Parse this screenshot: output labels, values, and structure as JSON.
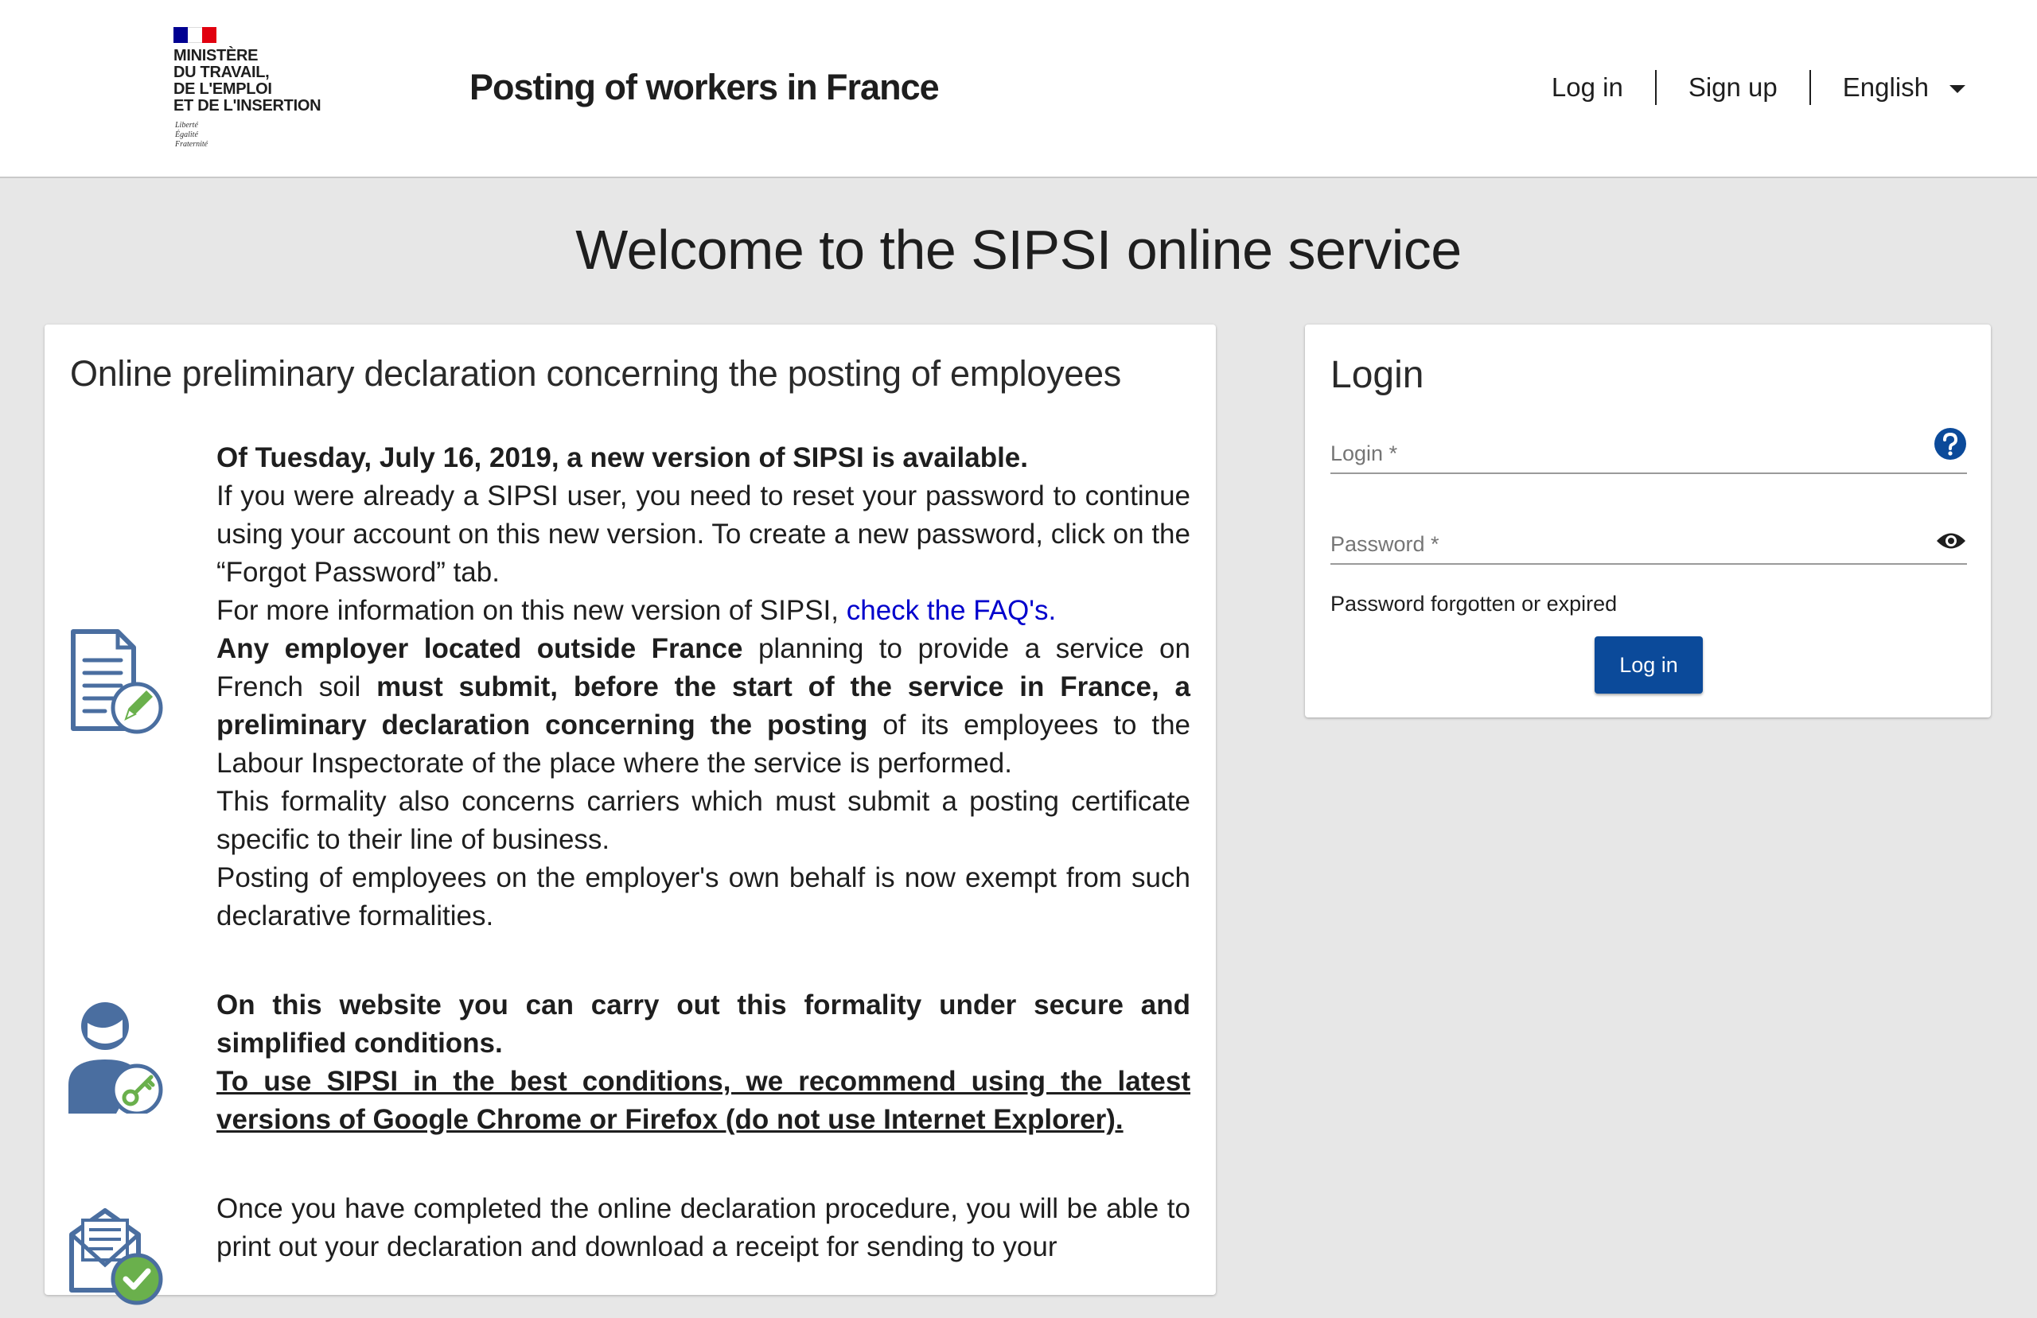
{
  "header": {
    "logo": {
      "flag_colors": [
        "#000091",
        "#ffffff",
        "#e1000f"
      ],
      "ministry": "MINISTÈRE\nDU TRAVAIL,\nDE L'EMPLOI\nET DE L'INSERTION",
      "motto": "Liberté\nÉgalité\nFraternité"
    },
    "site_title": "Posting of workers in France",
    "nav": {
      "login": "Log in",
      "signup": "Sign up",
      "language": "English"
    }
  },
  "welcome": "Welcome to the SIPSI online service",
  "info_card": {
    "title": "Online preliminary declaration concerning the posting of employees",
    "p1_bold": "Of Tuesday, July 16, 2019, a new version of SIPSI is available.",
    "p1_text": "If you were already a SIPSI user, you need to reset your password to continue using your account on this new version. To create a new password, click on the “Forgot Password” tab.",
    "p2_text": "For more information on this new version of SIPSI,",
    "p2_link": "check the FAQ's.",
    "p3_bold1": "Any employer located outside France",
    "p3_text1": "planning to provide a service on French soil",
    "p3_bold2": "must submit, before the start of the service in France, a preliminary declaration concerning the posting",
    "p3_text2": "of its employees to the Labour Inspectorate of the place where the service is performed.",
    "p4_text": "This formality also concerns carriers which must submit a posting certificate specific to their line of business.",
    "p5_text": "Posting of employees on the employer's own behalf is now exempt from such declarative formalities.",
    "p6_bold": "On this website you can carry out this formality under secure and simplified conditions.",
    "p6_underline": "To use SIPSI in the best conditions, we recommend using the latest versions of Google Chrome or Firefox (do not use Internet Explorer).",
    "p7_text": "Once you have completed the online declaration procedure, you will be able to print out your declaration and download a receipt for sending to your"
  },
  "login_card": {
    "title": "Login",
    "login_label": "Login  *",
    "password_label": "Password  *",
    "forgot": "Password forgotten or expired",
    "button": "Log in"
  },
  "colors": {
    "accent": "#0b4a9a",
    "icon_blue": "#4a6ea0",
    "icon_green": "#6ab04c",
    "link": "#0000cc"
  }
}
